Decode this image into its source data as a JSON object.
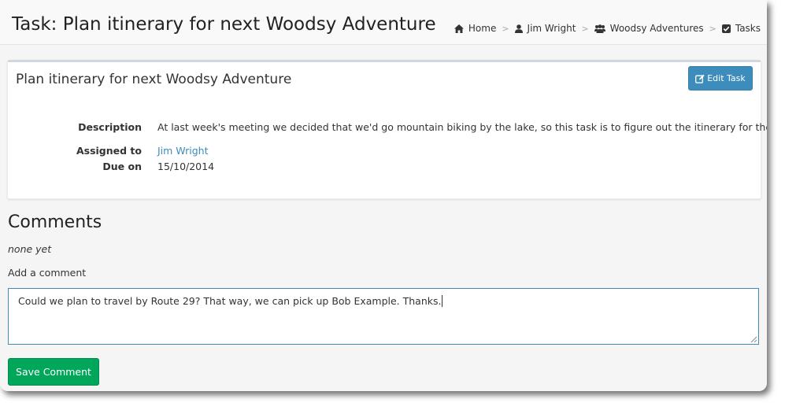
{
  "header": {
    "title": "Task: Plan itinerary for next Woodsy Adventure",
    "breadcrumb": [
      {
        "label": "Home",
        "icon": "home-icon"
      },
      {
        "label": "Jim Wright",
        "icon": "user-icon"
      },
      {
        "label": "Woodsy Adventures",
        "icon": "users-icon"
      },
      {
        "label": "Tasks",
        "icon": "check-square-icon"
      }
    ],
    "separator": ">"
  },
  "task": {
    "title": "Plan itinerary for next Woodsy Adventure",
    "edit_label": "Edit Task",
    "description_label": "Description",
    "description": "At last week's meeting we decided that we'd go mountain biking by the lake, so this task is to figure out the itinerary for the trip.",
    "assigned_label": "Assigned to",
    "assigned_to": "Jim Wright",
    "due_label": "Due on",
    "due_on": "15/10/2014"
  },
  "comments": {
    "heading": "Comments",
    "none_text": "none yet",
    "add_label": "Add a comment",
    "draft": "Could we plan to travel by Route 29? That way, we can pick up Bob Example. Thanks.",
    "save_label": "Save Comment"
  },
  "colors": {
    "primary": "#3c8dbc",
    "success": "#00a65a",
    "link": "#3c8dbc"
  }
}
